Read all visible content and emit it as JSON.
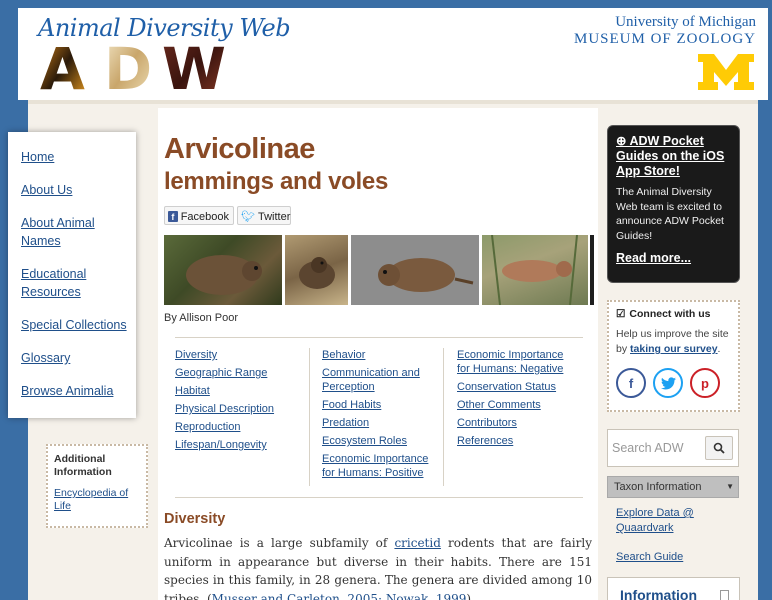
{
  "header": {
    "site_title": "Animal Diversity Web",
    "logo_letters": "ADW",
    "university_line1": "University of Michigan",
    "university_line2": "MUSEUM OF ZOOLOGY",
    "m_logo": "M"
  },
  "nav": {
    "items": [
      {
        "label": "Home"
      },
      {
        "label": "About Us"
      },
      {
        "label": "About Animal Names"
      },
      {
        "label": "Educational Resources"
      },
      {
        "label": "Special Collections"
      },
      {
        "label": "Glossary"
      },
      {
        "label": "Browse Animalia"
      }
    ]
  },
  "additional_info": {
    "title": "Additional Information",
    "link": "Encyclopedia of Life"
  },
  "article": {
    "taxon_name": "Arvicolinae",
    "common_name": "lemmings and voles",
    "share": {
      "facebook": "Facebook",
      "twitter": "Twitter"
    },
    "byline": "By Allison Poor",
    "toc": {
      "col1": [
        "Diversity",
        "Geographic Range",
        "Habitat",
        "Physical Description",
        "Reproduction",
        "Lifespan/Longevity"
      ],
      "col2": [
        "Behavior",
        "Communication and Perception",
        "Food Habits",
        "Predation",
        "Ecosystem Roles",
        "Economic Importance for Humans: Positive"
      ],
      "col3": [
        "Economic Importance for Humans: Negative",
        "Conservation Status",
        "Other Comments",
        "Contributors",
        "References"
      ]
    },
    "section_heading": "Diversity",
    "body": {
      "part1": "Arvicolinae is a large subfamily of ",
      "link1": "cricetid",
      "part2": " rodents that are fairly uniform in appearance but diverse in their habits. There are 151 species in this family, in 28 genera. The genera are divided among 10 tribes. (",
      "link2": "Musser and Carleton, 2005; Nowak, 1999",
      "part3": ")"
    }
  },
  "sidebar": {
    "promo": {
      "title": "ADW Pocket Guides on the iOS App Store!",
      "text": "The Animal Diversity Web team is excited to announce ADW Pocket Guides!",
      "read_more": "Read more..."
    },
    "connect": {
      "title": "Connect with us",
      "text_prefix": "Help us improve the site by ",
      "survey_link": "taking our survey",
      "text_suffix": "."
    },
    "search": {
      "placeholder": "Search ADW"
    },
    "taxon_select": {
      "value": "Taxon Information"
    },
    "explore_link": "Explore Data @ Quaardvark",
    "search_guide_link": "Search Guide",
    "info_box_title": "Information"
  },
  "colors": {
    "page_bg": "#3a6ea5",
    "title_brown": "#8a4b26",
    "link_blue": "#1f4f8a",
    "michigan_gold": "#ffcb05",
    "michigan_blue": "#1f5fa8"
  }
}
